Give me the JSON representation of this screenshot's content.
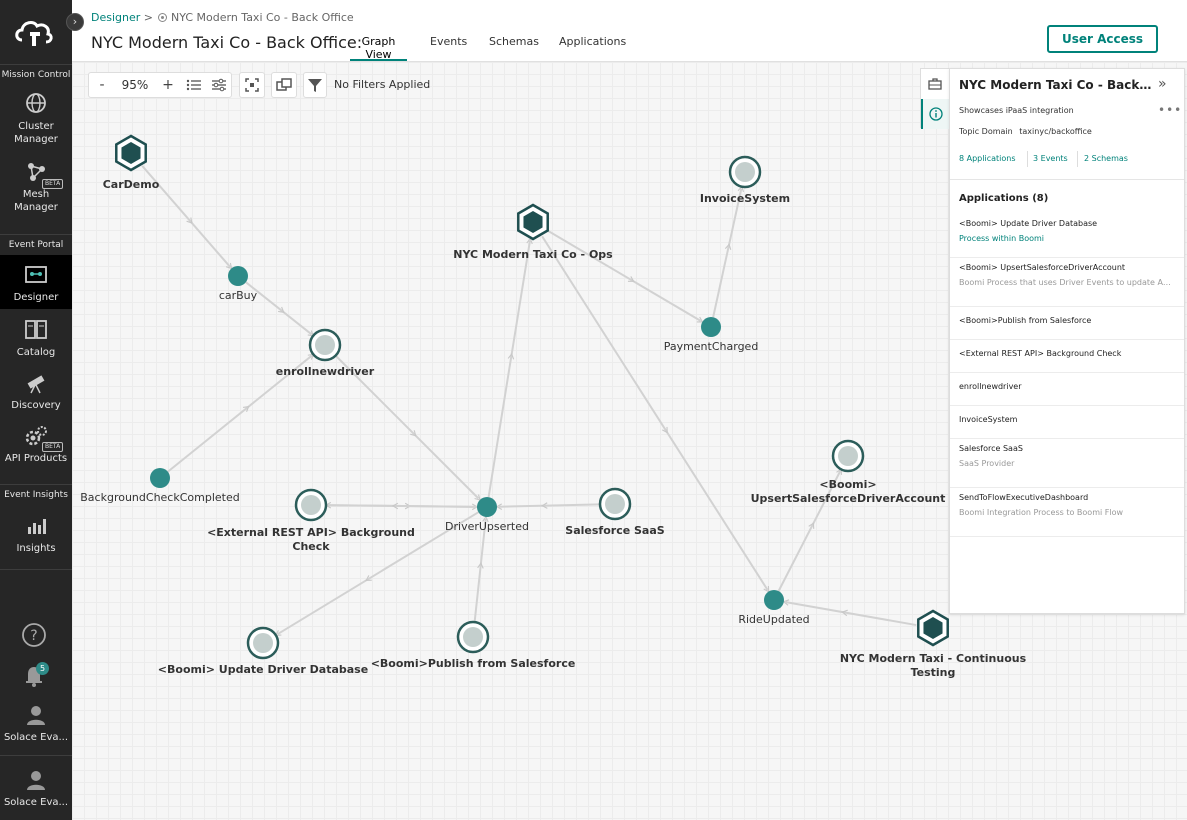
{
  "sidebar": {
    "sections": {
      "mission_control": "Mission Control",
      "event_portal": "Event Portal",
      "event_insights": "Event Insights"
    },
    "items": {
      "cluster_manager": [
        "Cluster",
        "Manager"
      ],
      "mesh_manager": [
        "Mesh",
        "Manager"
      ],
      "designer": "Designer",
      "catalog": "Catalog",
      "discovery": "Discovery",
      "api_products": "API Products",
      "insights": "Insights",
      "user1": "Solace Eva...",
      "user2": "Solace Eva..."
    },
    "beta_label": "BETA",
    "notification_count": "5"
  },
  "header": {
    "breadcrumb_root": "Designer",
    "breadcrumb_sep": ">",
    "breadcrumb_current": "NYC Modern Taxi Co - Back Office",
    "title": "NYC Modern Taxi Co - Back Office:",
    "tabs": [
      "Graph View",
      "Events",
      "Schemas",
      "Applications"
    ],
    "user_access": "User Access"
  },
  "toolbar": {
    "zoom_out": "-",
    "zoom": "95%",
    "zoom_in": "+",
    "filter": "No Filters Applied"
  },
  "graph": {
    "colors": {
      "teal": "#2e8b88",
      "dark": "#1f4f50",
      "edge": "#d2d2d2",
      "ring": "#2c5d5a",
      "ring_fill": "#c4cfcd"
    },
    "nodes": [
      {
        "id": "cardemo",
        "label": [
          "CarDemo"
        ],
        "kind": "hex"
      },
      {
        "id": "carbuy",
        "label": [
          "carBuy"
        ],
        "kind": "event"
      },
      {
        "id": "enrollnewdriver",
        "label": [
          "enrollnewdriver"
        ],
        "kind": "app"
      },
      {
        "id": "ops",
        "label": [
          "NYC Modern Taxi Co - Ops"
        ],
        "kind": "hex"
      },
      {
        "id": "invoicesystem",
        "label": [
          "InvoiceSystem"
        ],
        "kind": "app"
      },
      {
        "id": "paymentcharged",
        "label": [
          "PaymentCharged"
        ],
        "kind": "event"
      },
      {
        "id": "backgroundcheckcompleted",
        "label": [
          "BackgroundCheckCompleted"
        ],
        "kind": "event"
      },
      {
        "id": "extrest",
        "label": [
          "<External REST API> Background",
          "Check"
        ],
        "kind": "app"
      },
      {
        "id": "driverupserted",
        "label": [
          "DriverUpserted"
        ],
        "kind": "event"
      },
      {
        "id": "salesforcesaas",
        "label": [
          "Salesforce SaaS"
        ],
        "kind": "app"
      },
      {
        "id": "boomiupsert",
        "label": [
          "<Boomi>",
          "UpsertSalesforceDriverAccount"
        ],
        "kind": "app"
      },
      {
        "id": "updatedriverdb",
        "label": [
          "<Boomi> Update Driver Database"
        ],
        "kind": "app"
      },
      {
        "id": "publishsf",
        "label": [
          "<Boomi>Publish from Salesforce"
        ],
        "kind": "app"
      },
      {
        "id": "rideupdated",
        "label": [
          "RideUpdated"
        ],
        "kind": "event"
      },
      {
        "id": "continuoustesting",
        "label": [
          "NYC Modern Taxi - Continuous",
          "Testing"
        ],
        "kind": "hex"
      }
    ],
    "edges": [
      [
        "cardemo",
        "carbuy"
      ],
      [
        "carbuy",
        "enrollnewdriver"
      ],
      [
        "enrollnewdriver",
        "driverupserted"
      ],
      [
        "backgroundcheckcompleted",
        "enrollnewdriver"
      ],
      [
        "extrest",
        "driverupserted"
      ],
      [
        "driverupserted",
        "extrest"
      ],
      [
        "salesforcesaas",
        "driverupserted"
      ],
      [
        "publishsf",
        "driverupserted"
      ],
      [
        "driverupserted",
        "updatedriverdb"
      ],
      [
        "driverupserted",
        "ops"
      ],
      [
        "ops",
        "paymentcharged"
      ],
      [
        "paymentcharged",
        "invoicesystem"
      ],
      [
        "ops",
        "rideupdated"
      ],
      [
        "continuoustesting",
        "rideupdated"
      ],
      [
        "rideupdated",
        "boomiupsert"
      ]
    ]
  },
  "panel": {
    "title": "NYC Modern Taxi Co - Back Office",
    "description": "Showcases iPaaS integration",
    "topic_domain_label": "Topic Domain",
    "topic_domain_value": "taxinyc/backoffice",
    "stats": [
      "8  Applications",
      "3  Events",
      "2  Schemas"
    ],
    "apps_heading": "Applications (8)",
    "apps": [
      {
        "name": "<Boomi> Update Driver Database",
        "sub": "Process within Boomi",
        "sub_link": true
      },
      {
        "name": "<Boomi> UpsertSalesforceDriverAccount",
        "sub": "Boomi Process that uses Driver Events to update Account",
        "sub_link": false
      },
      {
        "name": "<Boomi>Publish from Salesforce",
        "sub": "",
        "sub_link": false
      },
      {
        "name": "<External REST API> Background Check",
        "sub": "",
        "sub_link": false
      },
      {
        "name": "enrollnewdriver",
        "sub": "",
        "sub_link": false
      },
      {
        "name": "InvoiceSystem",
        "sub": "",
        "sub_link": false
      },
      {
        "name": "Salesforce SaaS",
        "sub": "SaaS Provider",
        "sub_link": false
      },
      {
        "name": "SendToFlowExecutiveDashboard",
        "sub": "Boomi Integration Process to Boomi Flow",
        "sub_link": false
      }
    ]
  }
}
